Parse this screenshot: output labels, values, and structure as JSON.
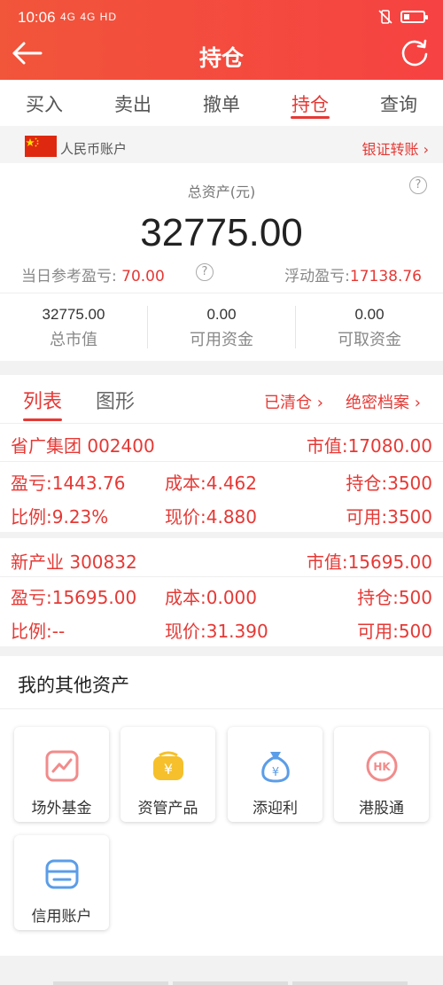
{
  "status": {
    "time": "10:06",
    "signal": "4G 4G HD"
  },
  "header": {
    "title": "持仓"
  },
  "tabs": [
    "买入",
    "卖出",
    "撤单",
    "持仓",
    "查询"
  ],
  "account": {
    "name": "人民币账户",
    "transfer": "银证转账"
  },
  "summary": {
    "assets_label": "总资产(元)",
    "assets_value": "32775.00",
    "daily_pl_label": "当日参考盈亏:",
    "daily_pl_value": "70.00",
    "float_pl_label": "浮动盈亏:",
    "float_pl_value": "17138.76",
    "stats": [
      {
        "value": "32775.00",
        "label": "总市值"
      },
      {
        "value": "0.00",
        "label": "可用资金"
      },
      {
        "value": "0.00",
        "label": "可取资金"
      }
    ]
  },
  "list": {
    "tab_list": "列表",
    "tab_chart": "图形",
    "closed": "已清仓",
    "archive": "绝密档案"
  },
  "holdings": [
    {
      "name": "省广集团 002400",
      "market_value": "市值:17080.00",
      "pl": "盈亏:1443.76",
      "cost": "成本:4.462",
      "position": "持仓:3500",
      "ratio": "比例:9.23%",
      "price": "现价:4.880",
      "available": "可用:3500"
    },
    {
      "name": "新产业 300832",
      "market_value": "市值:15695.00",
      "pl": "盈亏:15695.00",
      "cost": "成本:0.000",
      "position": "持仓:500",
      "ratio": "比例:--",
      "price": "现价:31.390",
      "available": "可用:500"
    }
  ],
  "other": {
    "title": "我的其他资产",
    "cards": [
      {
        "label": "场外基金",
        "icon": "fund-chart-icon",
        "color": "#f28b8b"
      },
      {
        "label": "资管产品",
        "icon": "yen-wallet-icon",
        "color": "#f5c02c"
      },
      {
        "label": "添迎利",
        "icon": "money-bag-icon",
        "color": "#5b9de8"
      },
      {
        "label": "港股通",
        "icon": "hk-coin-icon",
        "color": "#f28b8b"
      },
      {
        "label": "信用账户",
        "icon": "credit-card-icon",
        "color": "#5b9de8"
      }
    ]
  },
  "colors": {
    "primary": "#e53935",
    "header_start": "#f1553a",
    "header_end": "#f64242"
  }
}
